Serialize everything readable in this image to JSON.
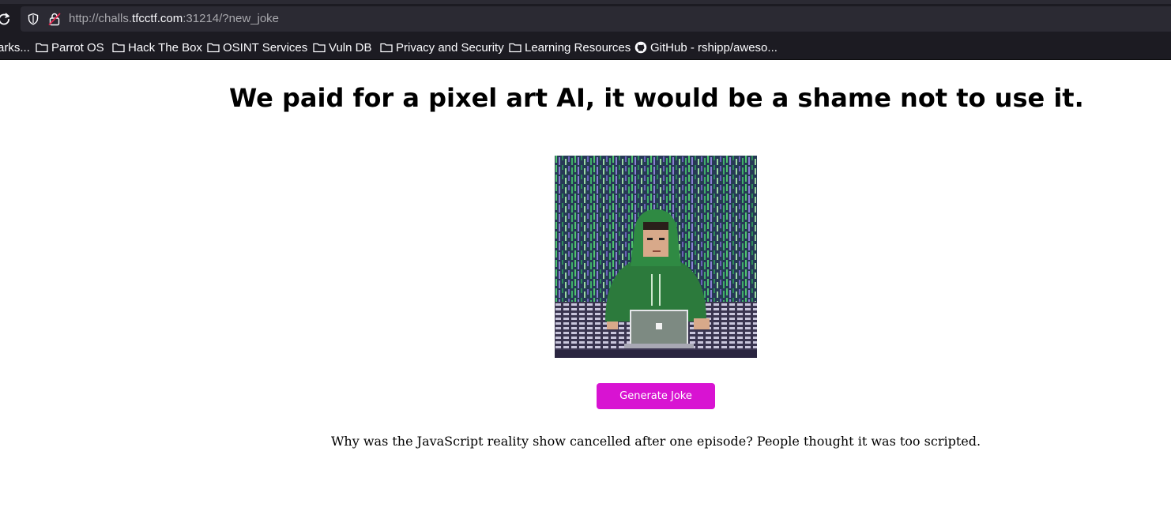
{
  "browser": {
    "url_scheme": "http://",
    "url_host_prefix": "challs.",
    "url_host_main": "tfcctf.com",
    "url_rest": ":31214/?new_joke",
    "bookmarks": [
      {
        "label": "arks...",
        "icon": "none"
      },
      {
        "label": "Parrot OS",
        "icon": "folder-icon"
      },
      {
        "label": "Hack The Box",
        "icon": "folder-icon"
      },
      {
        "label": "OSINT Services",
        "icon": "folder-icon"
      },
      {
        "label": "Vuln DB",
        "icon": "folder-icon"
      },
      {
        "label": "Privacy and Security",
        "icon": "folder-icon"
      },
      {
        "label": "Learning Resources",
        "icon": "folder-icon"
      },
      {
        "label": "GitHub - rshipp/aweso...",
        "icon": "github-icon"
      }
    ]
  },
  "page": {
    "title": "We paid for a pixel art AI, it would be a shame not to use it.",
    "button_label": "Generate Joke",
    "joke": "Why was the JavaScript reality show cancelled after one episode? People thought it was too scripted."
  },
  "colors": {
    "chrome_bg": "#1c1b22",
    "urlbar_bg": "#2b2a33",
    "button_bg": "#d813d2",
    "button_text": "#ffffff"
  }
}
